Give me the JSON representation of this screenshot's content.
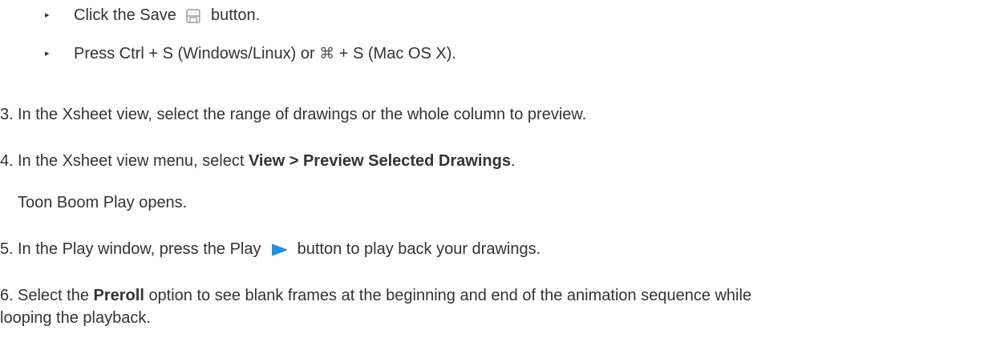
{
  "bullets": [
    {
      "pre": "Click the Save",
      "post": "button.",
      "icon": "save-icon"
    },
    {
      "pre": "Press Ctrl + S (Windows/Linux) or",
      "glyph": "⌘",
      "post": "+ S (Mac OS X)."
    }
  ],
  "steps": {
    "s3": {
      "number": "3.",
      "text": "In the Xsheet view, select the range of drawings or the whole column to preview."
    },
    "s4": {
      "number": "4.",
      "pre": "In the Xsheet view menu, select",
      "bold": "View > Preview Selected Drawings",
      "post": "."
    },
    "s4_note": "Toon Boom Play opens.",
    "s5": {
      "number": "5.",
      "pre": "In the Play window, press the Play",
      "post": "button to play back your drawings.",
      "icon": "play-icon"
    },
    "s6": {
      "number": "6.",
      "pre": "Select the",
      "bold": "Preroll",
      "post": "option to see blank frames at the beginning and end of the animation sequence while",
      "line2": "looping the playback."
    }
  },
  "bullet_glyph": "▸",
  "colors": {
    "text": "#333333",
    "play_icon": "#2a8fd6",
    "save_icon": "#9a9a9a"
  }
}
